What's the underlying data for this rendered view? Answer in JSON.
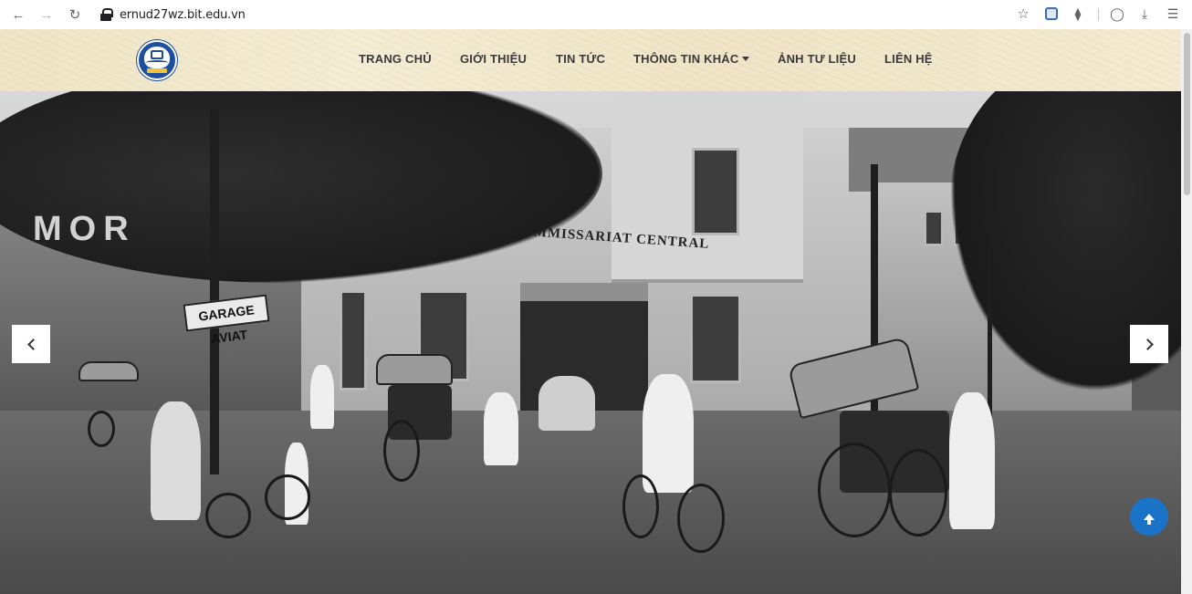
{
  "browser": {
    "url": "ernud27wz.bit.edu.vn",
    "icons": [
      "back-icon",
      "forward-icon",
      "reload-icon",
      "lock-icon",
      "star-icon",
      "extension-icon",
      "puzzle-icon",
      "profile-icon",
      "download-icon",
      "menu-icon"
    ]
  },
  "site": {
    "nav": [
      {
        "label": "TRANG CHỦ"
      },
      {
        "label": "GIỚI THIỆU"
      },
      {
        "label": "TIN TỨC"
      },
      {
        "label": "THÔNG TIN KHÁC",
        "has_dropdown": true
      },
      {
        "label": "ẢNH TƯ LIỆU"
      },
      {
        "label": "LIÊN HỆ"
      }
    ]
  },
  "hero": {
    "photo_signs": {
      "commissariat": "COMMISSARIAT CENTRAL",
      "garage": "GARAGE AVIAT",
      "shop": "MOR"
    },
    "prev_icon": "chevron-left-icon",
    "next_icon": "chevron-right-icon"
  },
  "back_to_top_icon": "arrow-up-icon",
  "colors": {
    "header_bg": "#efe4c6",
    "nav_text": "#3a3a3a",
    "back_to_top": "#1a73c7",
    "logo": "#1f4f9c"
  }
}
